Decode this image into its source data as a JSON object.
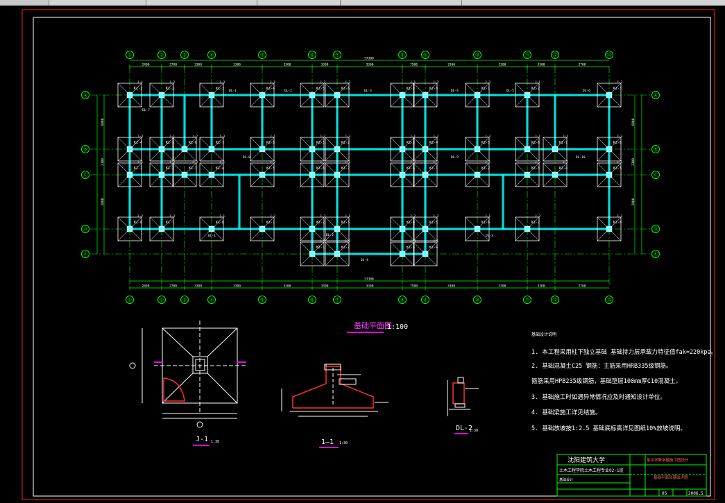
{
  "plan": {
    "title": "基础平面图",
    "scale": "1:100",
    "axes_top": [
      "①",
      "②",
      "③",
      "④",
      "⑤",
      "⑥",
      "⑦",
      "⑧",
      "⑨",
      "⑩",
      "⑪",
      "⑫",
      "⑬",
      "⑭"
    ],
    "axes_left": [
      "Ⓐ",
      "Ⓑ",
      "Ⓒ",
      "Ⓓ",
      "Ⓔ"
    ],
    "total_dim": "57300",
    "bay_dims": [
      "2400",
      "2700",
      "3300",
      "3300",
      "3300",
      "3300",
      "3300",
      "7500",
      "3300",
      "3300",
      "3300",
      "2700",
      "3600"
    ],
    "row_dims": [
      "6000",
      "2100",
      "5800"
    ],
    "col_labels": [
      "KZ-1",
      "KZ-2",
      "KZ-3",
      "KZ-4",
      "KZ-5",
      "KZ-6",
      "KZ-7",
      "KZ-8"
    ],
    "beam_labels": [
      "DL-1",
      "DL-2",
      "DL-3",
      "DL-4",
      "DL-5",
      "DL-6",
      "DL-7",
      "DL-8",
      "DL-9",
      "DL-10"
    ],
    "footing_labels": [
      "J-1",
      "J-2",
      "J-3"
    ]
  },
  "details": {
    "plan_detail_label": "J-1",
    "plan_detail_scale": "1:30",
    "section_label": "1—1",
    "section_scale": "1:30",
    "beam_label": "DL-2",
    "beam_scale": "1:30"
  },
  "notes": {
    "heading": "基础设计说明",
    "items": [
      "1. 本工程采用柱下独立基础  基础持力层承载力特征值fak=220kpa。",
      "2. 基础混凝土C25  钢筋：主筋采用HRB335级钢筋。",
      "   箍筋采用HPB235级钢筋，基础垫层100mm厚C10混凝土。",
      "3. 基础施工时如遇异常情况应及时通知设计单位。",
      "4. 基础梁施工详见结施。",
      "5. 基础放坡按1:2.5  基础底标高详见图纸10%放坡说明。"
    ]
  },
  "titleblock": {
    "school": "沈阳建筑大学",
    "project": "某中学教学楼施工图设计",
    "course": "土木工程学院土木工程专业02-1班",
    "drawing": "基础平面及基础详图",
    "row3": "基础设计",
    "sheet_no": "05",
    "date": "2006.5"
  },
  "colors": {
    "background": "#000000",
    "frame": "#ffffff",
    "border_red": "#ff0000",
    "axis_green": "#00ff00",
    "beam_cyan": "#00ffff",
    "title_magenta": "#ff00ff",
    "text_white": "#ffffff"
  }
}
